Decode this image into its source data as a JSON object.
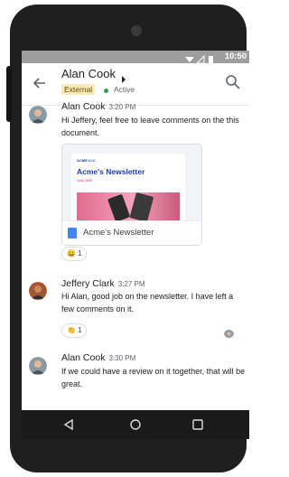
{
  "status_bar": {
    "time": "10:50"
  },
  "header": {
    "title": "Alan Cook",
    "badge": "External",
    "status": "Active",
    "icons": {
      "back": "arrow-back-icon",
      "chevron": "caret-right-icon",
      "search": "search-icon"
    }
  },
  "messages": [
    {
      "author": "Alan Cook",
      "time": "3:20 PM",
      "text": "Hi Jeffery, feel free to leave comments on the this document.",
      "attachment": {
        "brand": "ACME LLC",
        "headline": "Acme's Newsletter",
        "date": "Jul 6, 2020",
        "title": "Acme's Newsletter",
        "icon": "docs-icon"
      },
      "reaction": {
        "emoji": "😀",
        "count": "1"
      }
    },
    {
      "author": "Jeffery Clark",
      "time": "3:27 PM",
      "text": "Hi Alan, good job on the newsletter. I have left a few comments on it.",
      "reaction": {
        "emoji": "👏",
        "count": "1"
      }
    },
    {
      "author": "Alan Cook",
      "time": "3:30 PM",
      "text": "If we could have a review on it together, that will be great."
    }
  ],
  "nav_bar": {
    "icons": [
      "nav-back-icon",
      "nav-home-icon",
      "nav-recents-icon"
    ]
  },
  "colors": {
    "badge_bg": "#fbe9b7",
    "active_dot": "#2e9e49",
    "status_bar": "#9e9e9e",
    "accent": "#1a73e8"
  }
}
